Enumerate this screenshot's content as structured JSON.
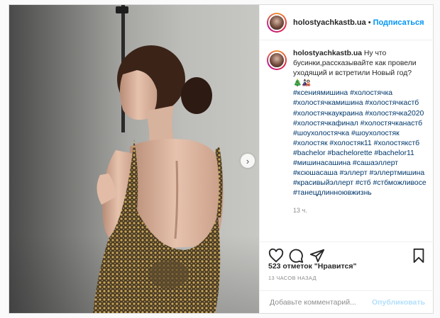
{
  "post": {
    "username": "holostyachkastb.ua",
    "separator": "•",
    "follow_label": "Подписаться",
    "caption": {
      "username": "holostyachkastb.ua",
      "text": "Ну что бусинки,рассказывайте как провели уходящий и встретили Новый год?",
      "emojis": "🎄🎎",
      "hashtags": [
        "#ксениямишина",
        "#холостячка",
        "#холостячкамишина",
        "#холостячкастб",
        "#холостячкаукраина",
        "#холостячка2020",
        "#холостячкафинал",
        "#холостячканастб",
        "#шоухолостячка",
        "#шоухолостяк",
        "#холостяк",
        "#холостяк11",
        "#холостякстб",
        "#bachelor",
        "#bachelorette",
        "#bachelor11",
        "#мишинасашина",
        "#сашаэллерт",
        "#ксюшасаша",
        "#эллерт",
        "#эллертмишина",
        "#красивыйэллерт",
        "#стб",
        "#стбможливосе",
        "#танецдлинноювжизнь"
      ],
      "time_ago": "13 ч."
    },
    "actions": {
      "like_icon": "heart-icon",
      "comment_icon": "comment-icon",
      "share_icon": "share-icon",
      "save_icon": "bookmark-icon"
    },
    "likes_text": "523 отметок \"Нравится\"",
    "timestamp": "13 ЧАСОВ НАЗАД",
    "comment": {
      "placeholder": "Добавьте комментарий...",
      "publish_label": "Опубликовать"
    },
    "colors": {
      "accent": "#0095f6",
      "publish_disabled": "#b2dffc",
      "hashtag": "#00376b",
      "text": "#262626",
      "muted": "#8e8e8e"
    }
  }
}
